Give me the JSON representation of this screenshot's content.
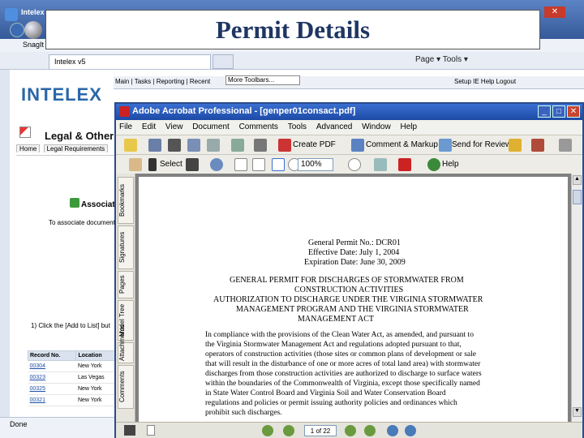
{
  "slide_title": "Permit Details",
  "browser": {
    "brand": "Intelex",
    "snagit_label": "SnagIt",
    "tab_label": "Intelex v5",
    "tools_row": "Page ▾  Tools ▾",
    "status_text": "Done"
  },
  "intelex": {
    "logo": "INTELEX",
    "nav_items": "Main | Tasks | Reporting | Recent",
    "nav_dropdown": "More Toolbars...",
    "setup_links": "Setup   IE   Help   Logout",
    "page_heading": "Legal & Other",
    "tabs": [
      "Home",
      "Legal Requirements"
    ],
    "associate_heading": "Associate",
    "associate_text": "To associate document",
    "step_text": "1) Click the [Add to List] but",
    "grid_headers": [
      "Record No.",
      "Location"
    ],
    "grid_rows": [
      {
        "record": "00304",
        "location": "New York"
      },
      {
        "record": "00323",
        "location": "Las Vegas"
      },
      {
        "record": "00325",
        "location": "New York"
      },
      {
        "record": "00321",
        "location": "New York"
      }
    ]
  },
  "acrobat": {
    "window_title": "Adobe Acrobat Professional - [genper01consact.pdf]",
    "menu": [
      "File",
      "Edit",
      "View",
      "Document",
      "Comments",
      "Tools",
      "Advanced",
      "Window",
      "Help"
    ],
    "toolbar1": {
      "create_pdf": "Create PDF",
      "comment_markup": "Comment & Markup",
      "send_review": "Send for Review"
    },
    "toolbar2": {
      "select": "Select",
      "zoom": "100%",
      "help": "Help"
    },
    "side_tabs": [
      "Bookmarks",
      "Signatures",
      "Pages",
      "Model Tree",
      "Attachments",
      "Comments"
    ],
    "page_indicator": "1 of 22"
  },
  "document": {
    "permit_no": "General Permit No.: DCR01",
    "effective_date": "Effective Date: July 1, 2004",
    "expiration_date": "Expiration Date: June 30, 2009",
    "heading_lines": [
      "GENERAL PERMIT FOR DISCHARGES OF STORMWATER FROM",
      "CONSTRUCTION ACTIVITIES",
      "AUTHORIZATION TO DISCHARGE UNDER THE VIRGINIA STORMWATER",
      "MANAGEMENT PROGRAM AND THE VIRGINIA STORMWATER",
      "MANAGEMENT ACT"
    ],
    "body_lines": [
      "In compliance with the provisions of the Clean Water Act, as amended, and pursuant to",
      "the Virginia Stormwater Management Act and regulations adopted pursuant to that,",
      "operators of construction activities (those sites or common plans of development or sale",
      "that will result in the disturbance of one or more acres of total land area) with stormwater",
      "discharges from those construction activities are authorized to discharge to surface waters",
      "within the boundaries of the Commonwealth of Virginia, except those specifically named",
      "in State Water Control Board and Virginia Soil and Water Conservation Board",
      "regulations and policies or permit issuing authority policies and ordinances which",
      "prohibit such discharges."
    ]
  }
}
